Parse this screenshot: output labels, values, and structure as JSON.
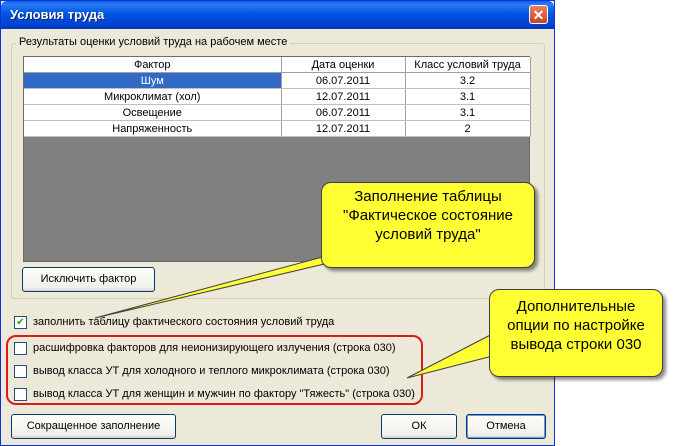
{
  "window": {
    "title": "Условия труда",
    "close_glyph": "✕"
  },
  "group": {
    "title": "Результаты оценки условий труда на рабочем месте"
  },
  "grid": {
    "columns": [
      "Фактор",
      "Дата оценки",
      "Класс условий труда"
    ],
    "rows": [
      {
        "factor": "Шум",
        "date": "06.07.2011",
        "class": "3.2",
        "selected": true
      },
      {
        "factor": "Микроклимат (хол)",
        "date": "12.07.2011",
        "class": "3.1"
      },
      {
        "factor": "Освещение",
        "date": "06.07.2011",
        "class": "3.1"
      },
      {
        "factor": "Напряженность",
        "date": "12.07.2011",
        "class": "2"
      }
    ]
  },
  "buttons": {
    "exclude": "Исключить фактор",
    "short_fill": "Сокращенное заполнение",
    "ok": "ОК",
    "cancel": "Отмена"
  },
  "checkboxes": [
    {
      "label": "заполнить таблицу фактического состояния условий труда",
      "checked": true
    },
    {
      "label": "расшифровка факторов для неионизирующего излучения (строка 030)",
      "checked": false
    },
    {
      "label": "вывод класса УТ для холодного и теплого микроклимата (строка 030)",
      "checked": false
    },
    {
      "label": "вывод класса УТ для женщин и мужчин по фактору \"Тяжесть\" (строка 030)",
      "checked": false
    }
  ],
  "checkmark_glyph": "✔",
  "callouts": {
    "fill_table": [
      "Заполнение таблицы",
      "\"Фактическое состояние",
      "условий труда\""
    ],
    "options": [
      "Дополнительные",
      "опции по настройке",
      "вывода строки 030"
    ]
  },
  "colors": {
    "title_bar": "#0055e3",
    "selection": "#316ac5",
    "callout": "#ffff33",
    "highlight_frame": "#e01a1a",
    "grid_empty": "#808080"
  }
}
